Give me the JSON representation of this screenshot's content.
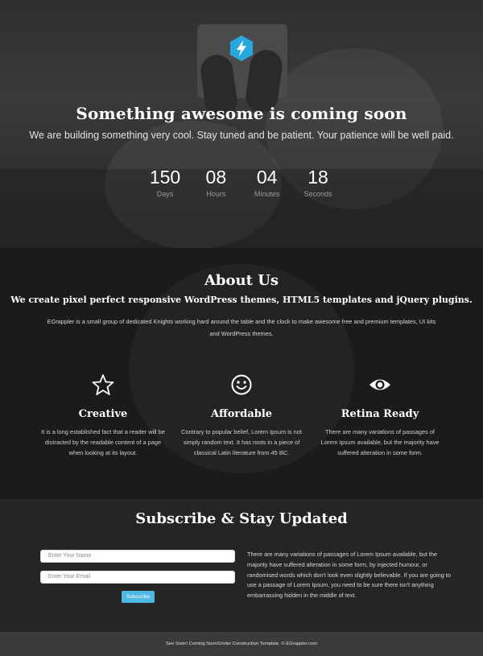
{
  "hero": {
    "title": "Something awesome is coming soon",
    "subtitle": "We are building something very cool. Stay tuned and be patient. Your patience will be well paid.",
    "logo_icon": "lightning-bolt-hexagon-icon",
    "countdown": [
      {
        "value": "150",
        "label": "Days"
      },
      {
        "value": "08",
        "label": "Hours"
      },
      {
        "value": "04",
        "label": "Minutes"
      },
      {
        "value": "18",
        "label": "Seconds"
      }
    ]
  },
  "about": {
    "title": "About Us",
    "tagline": "We create pixel perfect responsive WordPress themes, HTML5 templates and jQuery plugins.",
    "description": "EGrappler is a small group of dedicated Knights working hard around the table and the clock to make awesome free and premium templates, UI kits and WordPress themes.",
    "features": [
      {
        "icon": "star-icon",
        "title": "Creative",
        "text": "It is a long established fact that a reader will be distracted by the readable content of a page when looking at its layout."
      },
      {
        "icon": "smiley-icon",
        "title": "Affordable",
        "text": "Contrary to popular belief, Lorem Ipsum is not simply random text. It has roots in a piece of classical Latin literature from 45 BC."
      },
      {
        "icon": "eye-icon",
        "title": "Retina Ready",
        "text": "There are many variations of passages of Lorem Ipsum available, but the majority have suffered alteration in some form."
      }
    ]
  },
  "subscribe": {
    "title": "Subscribe & Stay Updated",
    "name_placeholder": "Enter Your Name",
    "email_placeholder": "Enter Your Email",
    "button_label": "Subscribe",
    "text": "There are many variations of passages of Lorem Ipsum available, but the majority have suffered alteration in some form, by injected humour, or randomised words which don't look even slightly believable. If you are going to use a passage of Lorem Ipsum, you need to be sure there isn't anything embarrassing hidden in the middle of text."
  },
  "footer": {
    "text": "See Soon! Coming Soon/Under Construction Template. © EGrappler.com"
  },
  "colors": {
    "accent": "#4fb7e3",
    "logo_blue": "#29a8e0"
  }
}
